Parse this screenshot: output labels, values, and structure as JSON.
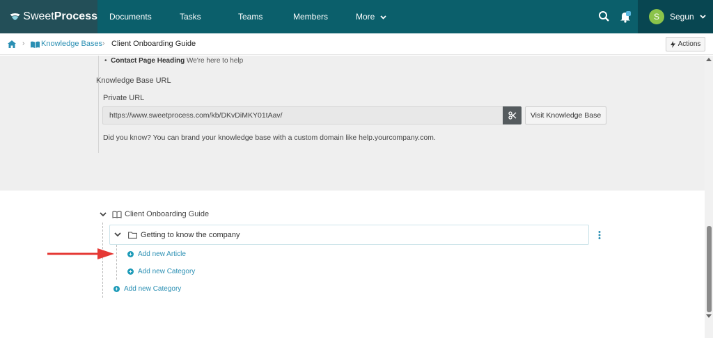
{
  "brand": {
    "name_part1": "Sweet",
    "name_part2": "Process",
    "accent": "#0b5f6b",
    "link": "#2a8fb3"
  },
  "nav": {
    "items": [
      {
        "label": "Documents"
      },
      {
        "label": "Tasks"
      },
      {
        "label": "Teams"
      },
      {
        "label": "Members"
      },
      {
        "label": "More"
      }
    ],
    "search_icon": "search-icon",
    "bell_icon": "bell-icon",
    "user": {
      "initial": "S",
      "name": "Segun"
    }
  },
  "breadcrumb": {
    "home_icon": "home-icon",
    "kb_label": "Knowledge Bases",
    "current": "Client Onboarding Guide"
  },
  "actions_label": "Actions",
  "settings": {
    "bullet_label": "Contact Page Heading",
    "bullet_value": "We're here to help",
    "kb_url_title": "Knowledge Base URL",
    "private_url_label": "Private URL",
    "private_url_value": "https://www.sweetprocess.com/kb/DKvDiMKY01tAav/",
    "copy_icon": "scissors-icon",
    "visit_label": "Visit Knowledge Base",
    "did_you_know": "Did you know? You can brand your knowledge base with a custom domain like help.yourcompany.com."
  },
  "tree": {
    "root_label": "Client Onboarding Guide",
    "category_label": "Getting to know the company",
    "add_article_label": "Add new Article",
    "add_sub_category_label": "Add new Category",
    "add_category_label": "Add new Category"
  },
  "annotation": {
    "arrow_color": "#e53935"
  }
}
